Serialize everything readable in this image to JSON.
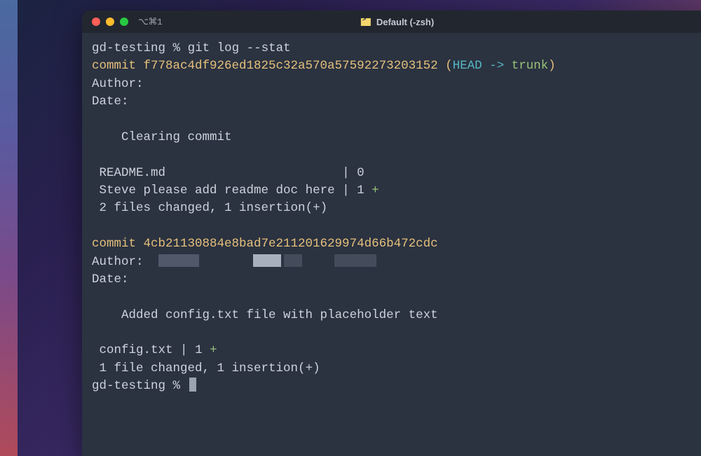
{
  "window": {
    "tab_indicator": "⌥⌘1",
    "title": "Default (-zsh)"
  },
  "colors": {
    "bg": "#2b3240",
    "titlebar": "#22272f",
    "text": "#cdd3dc",
    "yellow": "#e5c07b",
    "cyan": "#56b6c2",
    "green": "#98c379"
  },
  "prompt": {
    "dir": "gd-testing",
    "symbol": "%"
  },
  "command": "git log --stat",
  "log": [
    {
      "hash": "f778ac4df926ed1825c32a570a57592273203152",
      "ref_head": "HEAD -> ",
      "ref_branch": "trunk",
      "author_label": "Author:",
      "author_value": "",
      "date_label": "Date:",
      "date_value": "",
      "message": "Clearing commit",
      "stat_lines": [
        {
          "path": "README.md                       ",
          "sep": " | ",
          "count": "0",
          "diff": ""
        },
        {
          "path": "Steve please add readme doc here",
          "sep": " | ",
          "count": "1 ",
          "diff": "+"
        }
      ],
      "summary": "2 files changed, 1 insertion(+)"
    },
    {
      "hash": "4cb21130884e8bad7e211201629974d66b472cdc",
      "ref_head": "",
      "ref_branch": "",
      "author_label": "Author:",
      "author_value": "",
      "date_label": "Date:",
      "date_value": "",
      "message": "Added config.txt file with placeholder text",
      "stat_lines": [
        {
          "path": "config.txt",
          "sep": " | ",
          "count": "1 ",
          "diff": "+"
        }
      ],
      "summary": "1 file changed, 1 insertion(+)"
    }
  ]
}
